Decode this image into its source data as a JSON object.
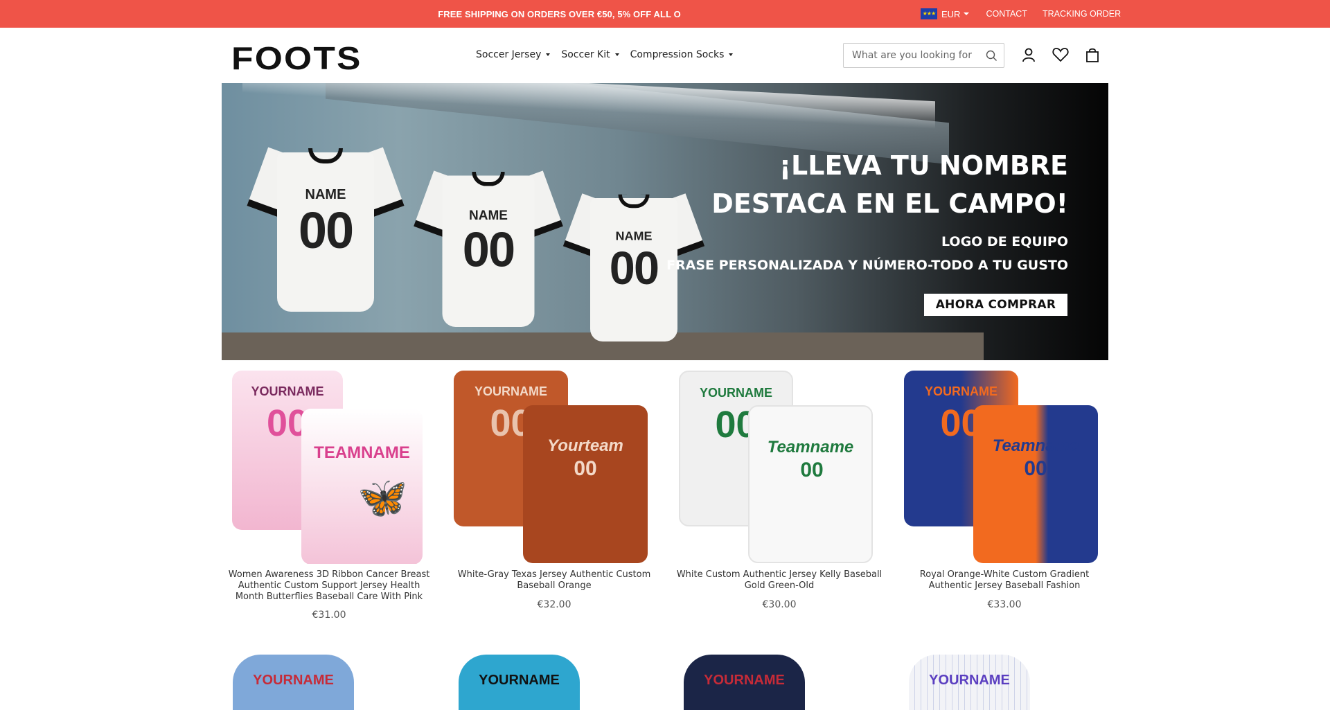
{
  "topbar": {
    "promo": "FREE SHIPPING ON ORDERS OVER €50, 5% OFF ALL O",
    "currency": "EUR",
    "contact": "CONTACT",
    "tracking": "TRACKING ORDER",
    "bg_color": "#ef5448"
  },
  "header": {
    "logo": "FOOTS",
    "nav": [
      "Soccer Jersey",
      "Soccer Kit",
      "Compression Socks"
    ],
    "search_placeholder": "What are you looking for",
    "icons": [
      "account-icon",
      "wishlist-icon",
      "cart-icon"
    ]
  },
  "banner": {
    "headline_1": "¡LLEVA TU NOMBRE",
    "headline_2": "DESTACA EN EL CAMPO!",
    "sub_1": "LOGO DE EQUIPO",
    "sub_2": "FRASE PERSONALIZADA Y NÚMERO-TODO A TU GUSTO",
    "cta": "AHORA COMPRAR",
    "jersey_name": "NAME",
    "jersey_number": "00"
  },
  "products": [
    {
      "title": "Women Awareness 3D Ribbon Cancer Breast Authentic Custom Support Jersey Health Month Butterflies Baseball Care With Pink",
      "price": "€31.00",
      "front_text": "YOURNAME",
      "back_text": "TEAMNAME",
      "number": "00",
      "colors": {
        "base": "#f6c9dc",
        "accent": "#e0509a",
        "alt": "#ffffff"
      }
    },
    {
      "title": "White-Gray Texas Jersey Authentic Custom Baseball Orange",
      "price": "€32.00",
      "front_text": "YOURNAME",
      "back_text": "Yourteam",
      "number": "00",
      "colors": {
        "base": "#c0582a",
        "accent": "#f3d9c8",
        "alt": "#a8461f"
      }
    },
    {
      "title": "White Custom Authentic Jersey Kelly Baseball Gold Green-Old",
      "price": "€30.00",
      "front_text": "YOURNAME",
      "back_text": "Teamname",
      "number": "00",
      "colors": {
        "base": "#f4f4f4",
        "accent": "#1f7a3e",
        "alt": "#ffffff"
      }
    },
    {
      "title": "Royal Orange-White Custom Gradient Authentic Jersey Baseball Fashion",
      "price": "€33.00",
      "front_text": "YOURNAME",
      "back_text": "Teamname",
      "number": "00",
      "colors": {
        "base": "#233a8e",
        "accent": "#f26a1f",
        "alt": "#ffffff"
      }
    }
  ],
  "row2": [
    {
      "text": "YOURNAME",
      "color": "#7fa8d9",
      "ink": "#c62b38"
    },
    {
      "text": "YOURNAME",
      "color": "#2ea6cf",
      "ink": "#111"
    },
    {
      "text": "YOURNAME",
      "color": "#1b2547",
      "ink": "#c62b38"
    },
    {
      "text": "YOURNAME",
      "color": "#f2f3f7",
      "ink": "#5a3ec0"
    }
  ]
}
